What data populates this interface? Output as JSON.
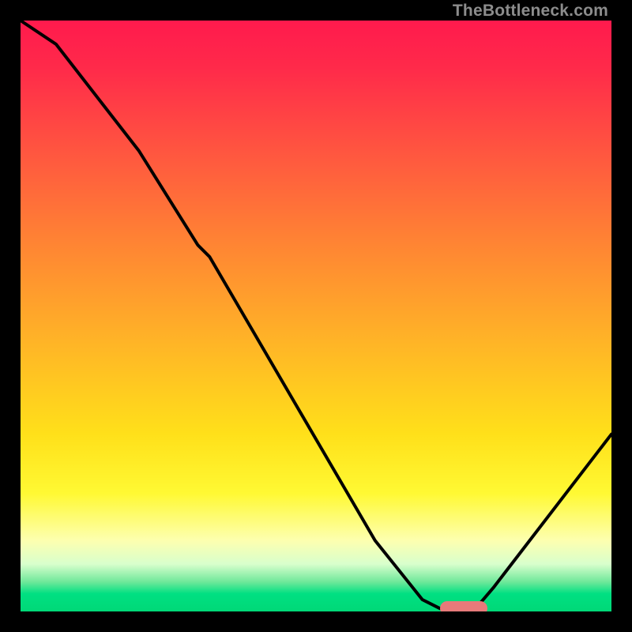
{
  "watermark": "TheBottleneck.com",
  "chart_data": {
    "type": "line",
    "title": "",
    "xlabel": "",
    "ylabel": "",
    "xlim": [
      0,
      100
    ],
    "ylim": [
      0,
      100
    ],
    "series": [
      {
        "name": "curve",
        "x": [
          0,
          6,
          20,
          30,
          32,
          60,
          68,
          71,
          77,
          80,
          100
        ],
        "values": [
          100,
          96,
          78,
          62,
          60,
          12,
          2,
          0.5,
          0.5,
          4,
          30
        ]
      }
    ],
    "marker": {
      "x_start": 71,
      "x_end": 79,
      "y": 0.5
    },
    "background_gradient": {
      "top": "#ff1a4d",
      "mid": "#ffe01a",
      "bottom": "#00d877"
    }
  }
}
